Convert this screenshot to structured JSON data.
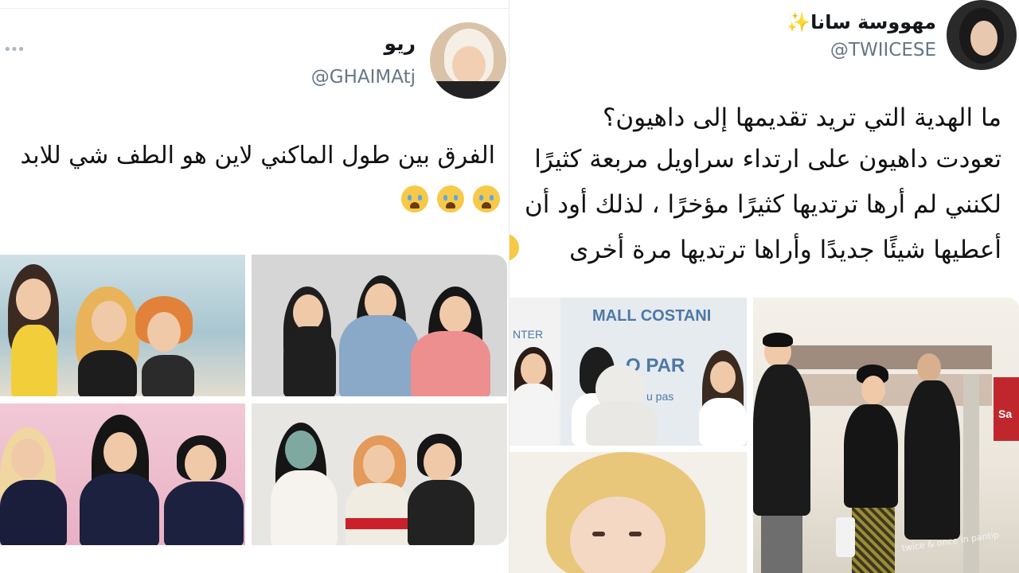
{
  "left_tweet": {
    "name": "ريو",
    "handle": "@GHAIMAtj",
    "text_line1": "الفرق بين طول الماكني لاين هو الطف شي للابد",
    "emoji": [
      "loudly-crying-face",
      "loudly-crying-face",
      "loudly-crying-face"
    ],
    "more_icon": "ellipsis-icon"
  },
  "right_tweet": {
    "name": "مهووسة سانا",
    "name_emoji": "✨",
    "handle": "@TWIICESE",
    "text_lines": [
      "ما الهدية التي تريد تقديمها إلى داهيون؟",
      "تعودت داهيون على ارتداء سراويل مربعة كثيرًا",
      "لكنني لم أرها ترتديها كثيرًا مؤخرًا ، لذلك أود أن",
      "أعطيها شيئًا جديدًا وأراها ترتديها مرة أخرى"
    ],
    "emoji": [
      "loudly-crying-face"
    ],
    "photo_texts": {
      "mall_sign": "MALL COSTANI",
      "sign_fragment_a": "NTER",
      "sign_fragment_b": "O PAR",
      "sign_fragment_c": "u pas",
      "watermark": "twice & once in pantip",
      "store_sign": "Sa"
    }
  },
  "colors": {
    "handle_gray": "#657786",
    "divider": "#e9e9e9",
    "emoji_yellow": "#f7c948"
  }
}
